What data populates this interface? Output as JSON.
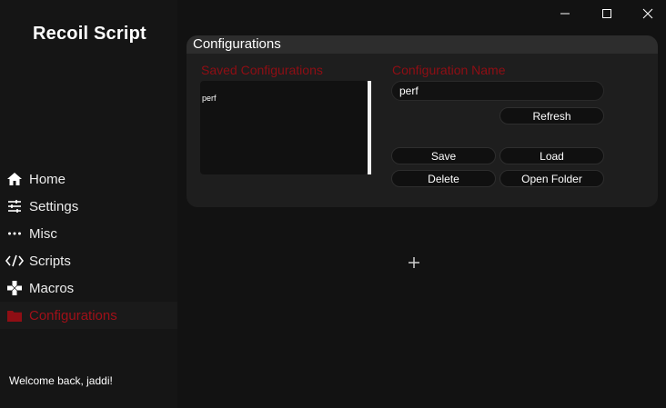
{
  "app": {
    "title": "Recoil Script"
  },
  "sidebar": {
    "items": [
      {
        "label": "Home",
        "icon": "home-icon"
      },
      {
        "label": "Settings",
        "icon": "sliders-icon"
      },
      {
        "label": "Misc",
        "icon": "more-icon"
      },
      {
        "label": "Scripts",
        "icon": "code-icon"
      },
      {
        "label": "Macros",
        "icon": "gamepad-icon"
      },
      {
        "label": "Configurations",
        "icon": "folder-icon",
        "active": true
      }
    ],
    "welcome": "Welcome back, jaddi!"
  },
  "panel": {
    "title": "Configurations",
    "saved_label": "Saved Configurations",
    "saved_items": [
      "perf"
    ],
    "name_label": "Configuration Name",
    "name_value": "perf",
    "buttons": {
      "refresh": "Refresh",
      "save": "Save",
      "load": "Load",
      "delete": "Delete",
      "open_folder": "Open Folder"
    }
  },
  "colors": {
    "accent": "#8f0e14",
    "sidebar_bg": "#151515",
    "main_bg": "#121212"
  }
}
